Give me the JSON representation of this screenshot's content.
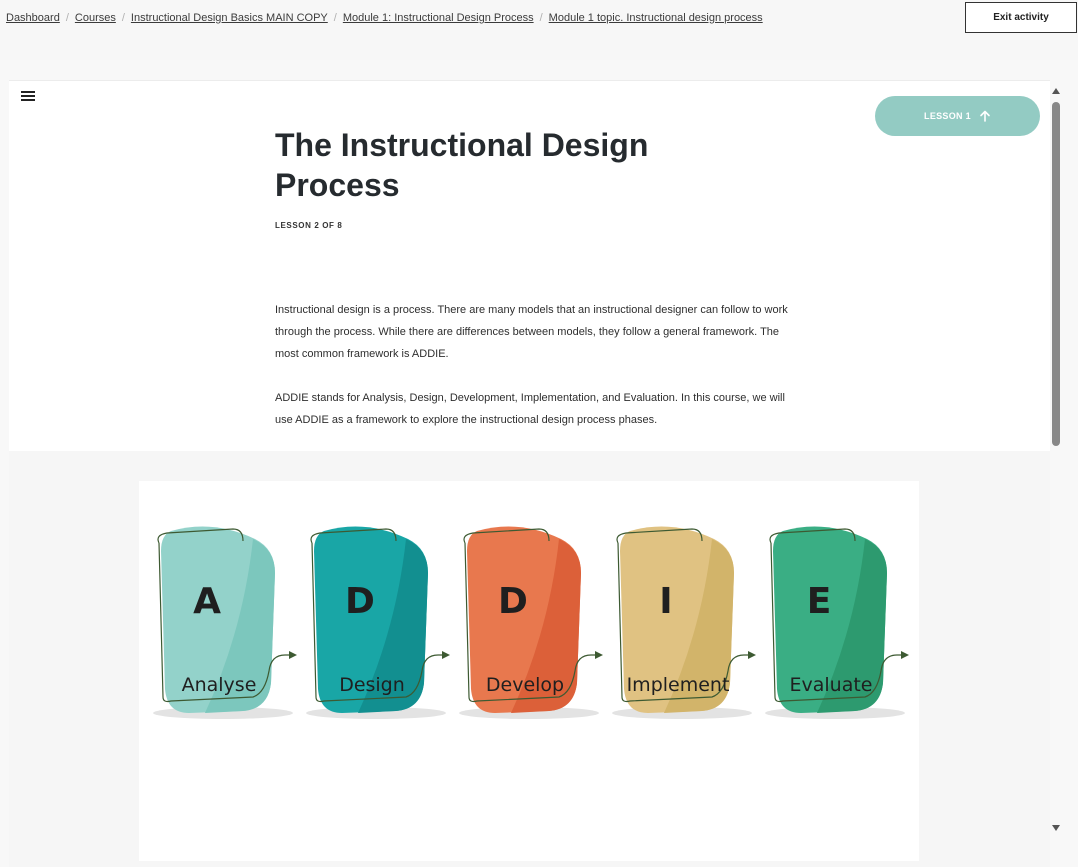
{
  "breadcrumb": [
    {
      "label": "Dashboard"
    },
    {
      "label": "Courses"
    },
    {
      "label": "Instructional Design Basics MAIN COPY"
    },
    {
      "label": "Module 1: Instructional Design Process"
    },
    {
      "label": "Module 1 topic. Instructional design process"
    }
  ],
  "header": {
    "exit_label": "Exit activity"
  },
  "lesson_nav": {
    "label": "LESSON 1",
    "icon": "arrow-up-icon"
  },
  "lesson": {
    "title": "The Instructional Design Process",
    "count": "LESSON 2 OF 8",
    "paragraphs": [
      "Instructional design is a process. There are many models that an instructional designer can follow to work through the process. While there are differences between models, they follow a general framework. The most common framework is ADDIE.",
      "ADDIE stands for Analysis, Design, Development, Implementation, and Evaluation. In this course, we will use ADDIE as a framework to explore the instructional design process phases."
    ]
  },
  "addie": [
    {
      "letter": "A",
      "word": "Analyse",
      "color": "#93d2ca",
      "shade": "#7cc7bd"
    },
    {
      "letter": "D",
      "word": "Design",
      "color": "#19a6a6",
      "shade": "#128f90"
    },
    {
      "letter": "D",
      "word": "Develop",
      "color": "#e8784e",
      "shade": "#dc6039"
    },
    {
      "letter": "I",
      "word": "Implement",
      "color": "#e0c282",
      "shade": "#d2b46a"
    },
    {
      "letter": "E",
      "word": "Evaluate",
      "color": "#3aae84",
      "shade": "#2d9a6f"
    }
  ],
  "colors": {
    "accent_pill": "#93cbc3",
    "outline": "#3d5a32"
  }
}
